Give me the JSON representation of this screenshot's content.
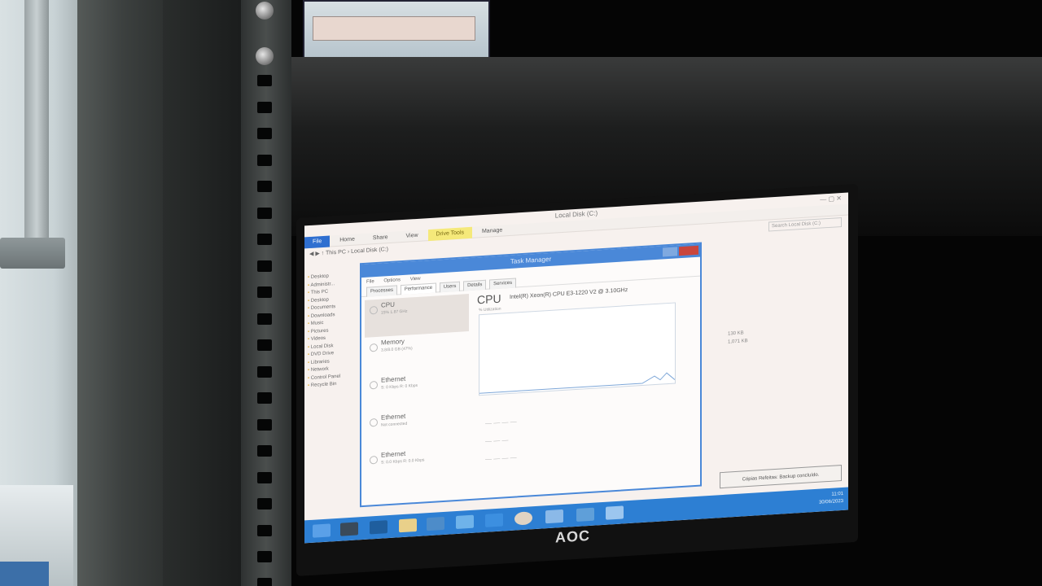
{
  "monitor": {
    "brand": "AOC"
  },
  "explorer": {
    "title": "Local Disk (C:)",
    "ribbon_tabs": [
      "File",
      "Home",
      "Share",
      "View",
      "Manage"
    ],
    "context_tab": "Drive Tools",
    "address": "This PC  ›  Local Disk (C:)",
    "search_placeholder": "Search Local Disk (C:)",
    "nav_items": [
      "Desktop",
      "Administr...",
      "This PC",
      "Desktop",
      "Documents",
      "Downloads",
      "Music",
      "Pictures",
      "Videos",
      "Local Disk",
      "DVD Drive",
      "Libraries",
      "Network",
      "Control Panel",
      "Recycle Bin"
    ],
    "sizes": [
      "130 KB",
      "1,071 KB"
    ]
  },
  "task_manager": {
    "title": "Task Manager",
    "menu": [
      "File",
      "Options",
      "View"
    ],
    "tabs": [
      "Processes",
      "Performance",
      "Users",
      "Details",
      "Services"
    ],
    "resources": [
      {
        "name": "CPU",
        "sub": "15% 1.87 GHz"
      },
      {
        "name": "Memory",
        "sub": "3.8/8.0 GB (47%)"
      },
      {
        "name": "Ethernet",
        "sub": "S: 0 Kbps  R: 0 Kbps"
      },
      {
        "name": "Ethernet",
        "sub": "Not connected"
      },
      {
        "name": "Ethernet",
        "sub": "S: 0.0 Kbps  R: 0.0 Kbps"
      }
    ],
    "heading": "CPU",
    "model": "Intel(R) Xeon(R) CPU E3-1220 V2 @ 3.10GHz",
    "util_label": "% Utilization"
  },
  "taskbar": {
    "lang": "POR\nPTB2",
    "time": "11:01",
    "date": "30/06/2023",
    "toast": "Cópias Refeitas: Backup concluído."
  }
}
